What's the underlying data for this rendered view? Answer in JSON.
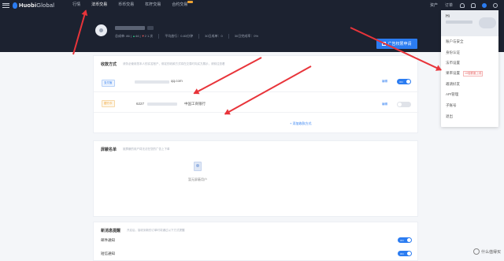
{
  "header": {
    "logo_brand": "Huobi",
    "logo_suffix": "Global",
    "nav": [
      {
        "label": "行情",
        "active": false
      },
      {
        "label": "法币交易",
        "active": true
      },
      {
        "label": "币币交易",
        "active": false
      },
      {
        "label": "杠杆交易",
        "active": false
      },
      {
        "label": "合约交易",
        "active": false
      }
    ],
    "right": {
      "assets": "资产",
      "orders": "订单"
    }
  },
  "profile": {
    "stats": {
      "total": "总成单: 86",
      "good": "44",
      "bad": "2",
      "times_suffix": "1 次",
      "release": "平均放行：0.83分钟",
      "month_count": "30日成单：0",
      "month_rate": "30日完成率：0%"
    },
    "ad_button": "广告权限申请"
  },
  "payment": {
    "title": "收款方式",
    "hint": "请务必使用您本人的实名账户，绑定的收款方式将在交易时向买方展示，请前往查看",
    "rows": [
      {
        "tag": "支付宝",
        "suffix": "qq.com",
        "edit": "编辑",
        "toggle": "ON"
      },
      {
        "tag": "银行卡",
        "prefix": "6227",
        "bank": "中国工商银行",
        "edit": "编辑",
        "toggle": ""
      }
    ],
    "add": "+ 添加收款方式"
  },
  "blacklist": {
    "title": "屏蔽名单",
    "hint": "被屏蔽的用户将无法在您的广告上下单",
    "empty": "暂无屏蔽用户"
  },
  "notify": {
    "title": "新消息提醒",
    "hint": "开启后，接收到新的订单时将通过以下方式提醒",
    "items": [
      {
        "label": "邮件通知",
        "toggle": "ON"
      },
      {
        "label": "短信通知",
        "toggle": "ON"
      }
    ]
  },
  "dropdown": {
    "greeting": "Hi",
    "items": [
      {
        "label": "账户与安全"
      },
      {
        "label": "身份认证"
      },
      {
        "label": "法币设置"
      },
      {
        "label": "果率设置",
        "tip": "10倍额度上线"
      },
      {
        "label": "邀请好友"
      },
      {
        "label": "API管理"
      },
      {
        "label": "子账号"
      },
      {
        "label": "退出"
      }
    ]
  },
  "watermark": "什么值得买",
  "colors": {
    "topbar": "#1c2230",
    "accent": "#2b7cf1",
    "arrow": "#e8343a"
  }
}
